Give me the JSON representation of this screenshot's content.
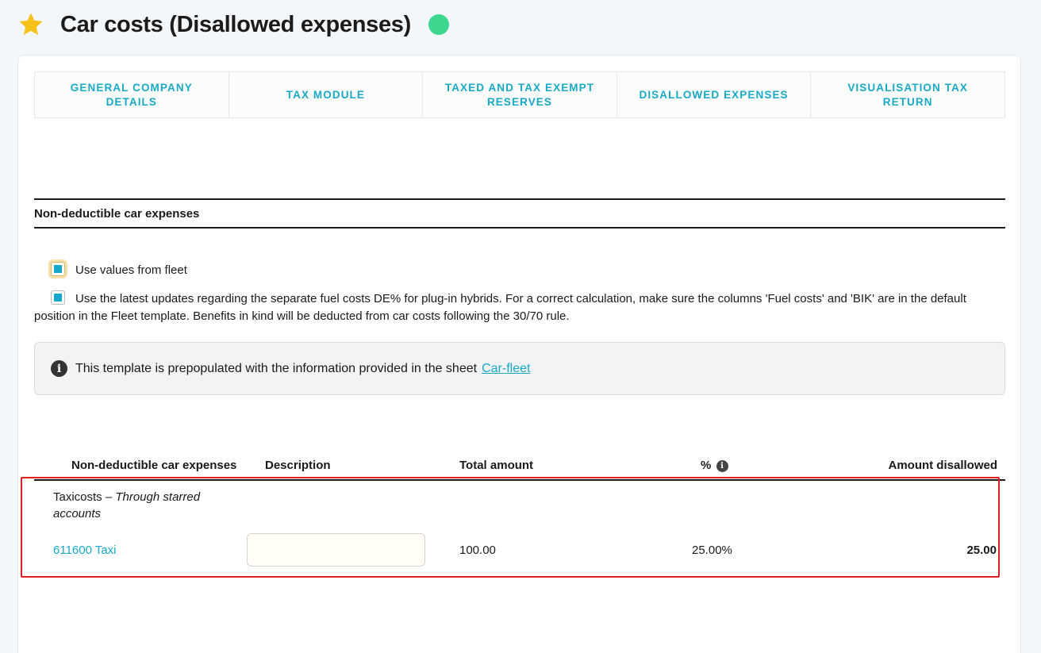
{
  "header": {
    "title": "Car costs (Disallowed expenses)",
    "star_color": "#f5c11a",
    "status_color": "#3cd68f"
  },
  "tabs": [
    {
      "label": "GENERAL COMPANY DETAILS"
    },
    {
      "label": "TAX MODULE"
    },
    {
      "label": "TAXED AND TAX EXEMPT RESERVES"
    },
    {
      "label": "DISALLOWED EXPENSES"
    },
    {
      "label": "VISUALISATION TAX RETURN"
    }
  ],
  "section": {
    "title": "Non-deductible car expenses"
  },
  "options": {
    "use_fleet": "Use values from fleet",
    "use_latest": "Use the latest updates regarding the separate fuel costs DE% for plug-in hybrids. For a correct calculation, make sure the columns 'Fuel costs' and 'BIK' are in the default position in the Fleet template. Benefits in kind will be deducted from car costs following the 30/70 rule."
  },
  "info": {
    "text": "This template is prepopulated with the information provided in the sheet",
    "link": "Car-fleet"
  },
  "table": {
    "columns": {
      "expenses": "Non-deductible car expenses",
      "description": "Description",
      "total": "Total amount",
      "percent": "%",
      "disallowed": "Amount disallowed"
    },
    "group": {
      "name": "Taxicosts",
      "separator": "–",
      "note": "Through starred accounts"
    },
    "row": {
      "account": "611600 Taxi",
      "description": "",
      "total": "100.00",
      "percent": "25.00%",
      "disallowed": "25.00"
    }
  },
  "colors": {
    "accent": "#19a9c6",
    "highlight": "#e02020"
  }
}
